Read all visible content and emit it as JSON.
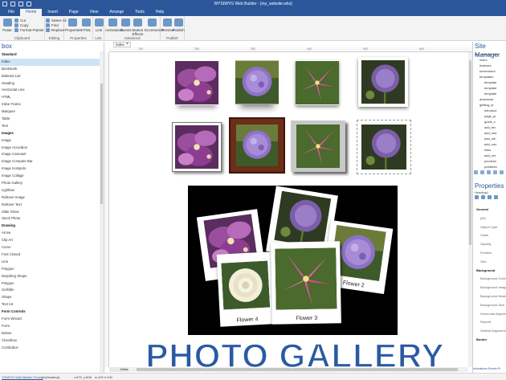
{
  "window": {
    "title": "WYSIWYG Web Builder - [my_website.wbs]"
  },
  "menu": [
    {
      "id": "file",
      "label": "File"
    },
    {
      "id": "home",
      "label": "Home"
    },
    {
      "id": "insert",
      "label": "Insert"
    },
    {
      "id": "page",
      "label": "Page"
    },
    {
      "id": "view",
      "label": "View"
    },
    {
      "id": "arrange",
      "label": "Arrange"
    },
    {
      "id": "tools",
      "label": "Tools"
    },
    {
      "id": "help",
      "label": "Help"
    }
  ],
  "ribbon": {
    "paste": "Paste",
    "cut": "Cut",
    "copy": "Copy",
    "format_painter": "Format Painter",
    "select_all": "Select All",
    "find": "Find",
    "replace": "Replace",
    "properties": "Properties",
    "html": "HTML",
    "link": "Link",
    "animations": "Animations",
    "events": "Events",
    "motion_effects": "Motion Effects",
    "ecommerce": "Ecommerce",
    "preview": "Preview",
    "publish": "Publish",
    "groups": {
      "clipboard": "Clipboard",
      "editing": "Editing",
      "properties": "Properties",
      "link": "Link",
      "advanced": "Advanced",
      "publish": "Publish"
    }
  },
  "toolbox": {
    "title": "box",
    "items": [
      {
        "label": "Standard",
        "type": "hdr"
      },
      {
        "label": "Index",
        "type": "sel"
      },
      {
        "label": "Bookmark"
      },
      {
        "label": "Bulleted List"
      },
      {
        "label": "Heading"
      },
      {
        "label": "Horizontal Line"
      },
      {
        "label": "HTML"
      },
      {
        "label": "Inline Frame"
      },
      {
        "label": "Marquee"
      },
      {
        "label": "Table"
      },
      {
        "label": "Text"
      },
      {
        "label": "Images",
        "type": "hdr"
      },
      {
        "label": "Image"
      },
      {
        "label": "Image Accordion"
      },
      {
        "label": "Image Carousel"
      },
      {
        "label": "Image Compare Bar"
      },
      {
        "label": "Image Hotspots"
      },
      {
        "label": "Image Collage"
      },
      {
        "label": "Photo Gallery"
      },
      {
        "label": "Lightbox"
      },
      {
        "label": "Rollover Image"
      },
      {
        "label": "Rollover Text"
      },
      {
        "label": "Slide Show"
      },
      {
        "label": "Stock Photo"
      },
      {
        "label": "Drawing",
        "type": "hdr"
      },
      {
        "label": "Arrow"
      },
      {
        "label": "Clip Art"
      },
      {
        "label": "Curve"
      },
      {
        "label": "Font Closed"
      },
      {
        "label": "Line"
      },
      {
        "label": "Polygon"
      },
      {
        "label": "Morphing Shape"
      },
      {
        "label": "Polygon"
      },
      {
        "label": "Scribble"
      },
      {
        "label": "Shape"
      },
      {
        "label": "Text Art"
      },
      {
        "label": "Form Controls",
        "type": "hdr"
      },
      {
        "label": "Form Wizard"
      },
      {
        "label": "Form"
      },
      {
        "label": "Button"
      },
      {
        "label": "Checkbox"
      },
      {
        "label": "Combobox"
      }
    ]
  },
  "document": {
    "tab": "index",
    "bottom_tab": "Default",
    "ruler_marks": [
      "100",
      "200",
      "300",
      "400",
      "500",
      "600"
    ]
  },
  "gallery": {
    "captions": [
      "Flower 4",
      "Flower 3",
      "Flower 2"
    ]
  },
  "overlay_title": "PHOTO GALLERY",
  "site_manager": {
    "title": "Site Manager",
    "tree": [
      "my_website.wbs",
      "index",
      "features",
      "screenshot",
      "templates",
      "template",
      "template",
      "template",
      "download",
      "getting_st",
      "introduct",
      "page_pr",
      "guide_c",
      "add_tex",
      "add_ima",
      "add_oth",
      "add_nav",
      "links",
      "add_me",
      "previewi",
      "publishin"
    ]
  },
  "properties": {
    "title": "Properties",
    "subtitle": "Heading1",
    "rows": [
      {
        "label": "General",
        "type": "hdr"
      },
      {
        "label": "(ID)"
      },
      {
        "label": "Object Type"
      },
      {
        "label": "Class"
      },
      {
        "label": "Opacity"
      },
      {
        "label": "Position"
      },
      {
        "label": "Size"
      },
      {
        "label": "Background",
        "type": "hdr"
      },
      {
        "label": "Background Color"
      },
      {
        "label": "Background Image"
      },
      {
        "label": "Background Mode"
      },
      {
        "label": "Background Size"
      },
      {
        "label": "Horizontal Alignment"
      },
      {
        "label": "Repeat"
      },
      {
        "label": "Vertical Alignment"
      },
      {
        "label": "Border",
        "type": "hdr"
      }
    ],
    "tabs": "Animations  Events  Pr"
  },
  "status": {
    "link": "YSIWYG Web Builder Forum",
    "id": "(id)Heading1",
    "pos": "x:675, y:508",
    "size": "w:100 h:100"
  },
  "colors": {
    "accent": "#2b579a",
    "overlay": "#2a5aa3"
  }
}
